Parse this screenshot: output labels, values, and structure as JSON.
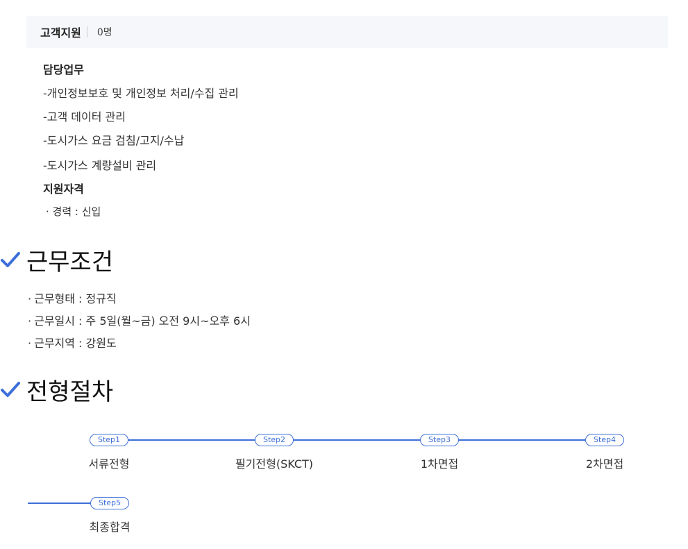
{
  "job": {
    "title": "고객지원",
    "count": "0명",
    "duties_heading": "담당업무",
    "duties": [
      "-개인정보보호 및 개인정보 처리/수집 관리",
      "-고객 데이터 관리",
      "-도시가스 요금 검침/고지/수납",
      "-도시가스 계량설비 관리"
    ],
    "qualification_heading": "지원자격",
    "qualifications": [
      "· 경력 : 신입"
    ]
  },
  "conditions": {
    "title": "근무조건",
    "items": [
      "근무형태 : 정규직",
      "근무일시 : 주 5일(월~금) 오전 9시~오후 6시",
      "근무지역 : 강원도"
    ],
    "bullet": "·"
  },
  "process": {
    "title": "전형절차",
    "steps": [
      {
        "badge": "Step1",
        "label": "서류전형"
      },
      {
        "badge": "Step2",
        "label": "필기전형(SKCT)"
      },
      {
        "badge": "Step3",
        "label": "1차면접"
      },
      {
        "badge": "Step4",
        "label": "2차면접"
      },
      {
        "badge": "Step5",
        "label": "최종합격"
      }
    ]
  },
  "colors": {
    "accent": "#3d6fd9",
    "header_bg": "#f6f7fb"
  },
  "icons": {
    "section_marker": "check-icon"
  }
}
